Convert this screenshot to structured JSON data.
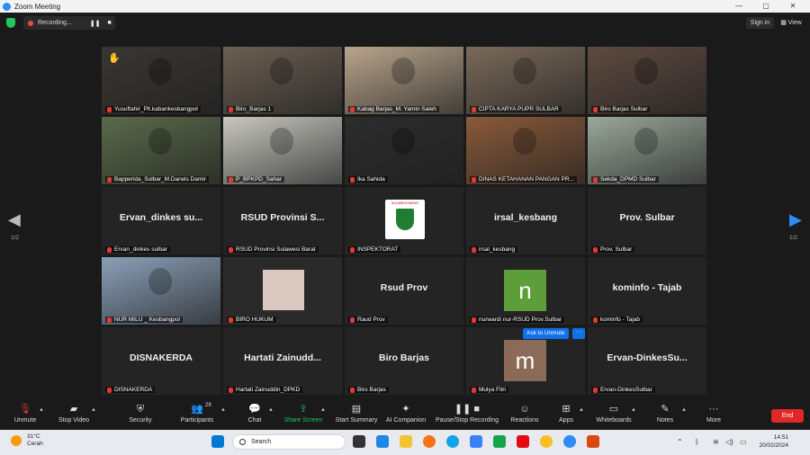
{
  "window": {
    "title": "Zoom Meeting",
    "controls": [
      "—",
      "▢",
      "✕"
    ]
  },
  "recording": {
    "label": "Recording...",
    "pause_icon": "pause-icon",
    "stop_icon": "stop-icon"
  },
  "topbar": {
    "sign_in": "Sign in",
    "view": "View"
  },
  "page_indicator": {
    "left": "1/2",
    "right": "1/2"
  },
  "tiles": [
    {
      "name": "Yusuftahir_Plt.kabankesbangpol",
      "type": "video",
      "color": "#3a3632",
      "hand": "✋"
    },
    {
      "name": "Biro_Barjas 1",
      "type": "video",
      "color": "#6b5f52"
    },
    {
      "name": "Kabag Barjas_M. Yamin Saleh",
      "type": "video",
      "color": "#b9a58c",
      "active": true
    },
    {
      "name": "CIPTA KARYA PUPR SULBAR",
      "type": "video",
      "color": "#7a6a5a"
    },
    {
      "name": "Biro Barjas Sulbar",
      "type": "video",
      "color": "#5e4a40"
    },
    {
      "name": "Bapperida_Sulbar_M.Darwis Damir",
      "type": "video",
      "color": "#5a6a4a"
    },
    {
      "name": "P_BPKPD_Sahar",
      "type": "video",
      "color": "#c8c8c0"
    },
    {
      "name": "Ika Sahida",
      "type": "video",
      "color": "#2c2c2c"
    },
    {
      "name": "DINAS KETAHANAN PANGAN PR...",
      "type": "video",
      "color": "#8a5a3a"
    },
    {
      "name": "Sekda_DPMD Sulbar",
      "type": "video",
      "color": "#9aa89a"
    },
    {
      "name": "Ervan_dinkes sulbar",
      "type": "text",
      "big": "Ervan_dinkes su..."
    },
    {
      "name": "RSUD Provinsi Sulawesi Barat",
      "type": "text",
      "big": "RSUD Provinsi S..."
    },
    {
      "name": "INSPEKTORAT",
      "type": "logo",
      "logo_text": "SULAWESI BARAT"
    },
    {
      "name": "irsal_kesbang",
      "type": "text",
      "big": "irsal_kesbang"
    },
    {
      "name": "Prov. Sulbar",
      "type": "text",
      "big": "Prov. Sulbar"
    },
    {
      "name": "NUR MILU _ Kesbangpol",
      "type": "video",
      "color": "#8aa0b8"
    },
    {
      "name": "BIRO HUKUM",
      "type": "photo",
      "color": "#d8c8c0"
    },
    {
      "name": "Raud Prov",
      "type": "text",
      "big": "Rsud Prov"
    },
    {
      "name": "nurwardi nur-RSUD Prov.Sulbar",
      "type": "avatar",
      "letter": "n",
      "color": "#5d9e3a"
    },
    {
      "name": "kominfo - Tajab",
      "type": "text",
      "big": "kominfo - Tajab"
    },
    {
      "name": "DISNAKERDA",
      "type": "text",
      "big": "DISNAKERDA"
    },
    {
      "name": "Hartati Zainuddin_DPKD",
      "type": "text",
      "big": "Hartati Zainudd..."
    },
    {
      "name": "Biro Barjas",
      "type": "text",
      "big": "Biro Barjas"
    },
    {
      "name": "Mulya Fitri",
      "type": "avatar",
      "letter": "m",
      "color": "#8c6a58"
    },
    {
      "name": "Ervan-DinkesSulbar",
      "type": "text",
      "big": "Ervan-DinkesSu..."
    }
  ],
  "popover": {
    "ask_to_unmute": "Ask to Unmute",
    "more": "···"
  },
  "toolbar": {
    "unmute": "Unmute",
    "stop_video": "Stop Video",
    "security": "Security",
    "participants": "Participants",
    "participants_count": "29",
    "chat": "Chat",
    "share_screen": "Share Screen",
    "start_summary": "Start Summary",
    "ai_companion": "AI Companion",
    "pause_stop_recording": "Pause/Stop Recording",
    "reactions": "Reactions",
    "apps": "Apps",
    "whiteboards": "Whiteboards",
    "notes": "Notes",
    "more": "More",
    "end": "End"
  },
  "taskbar": {
    "weather_temp": "31°C",
    "weather_desc": "Cerah",
    "search_placeholder": "Search",
    "time": "14:51",
    "date": "20/02/2024",
    "accent": "#0e71eb"
  }
}
